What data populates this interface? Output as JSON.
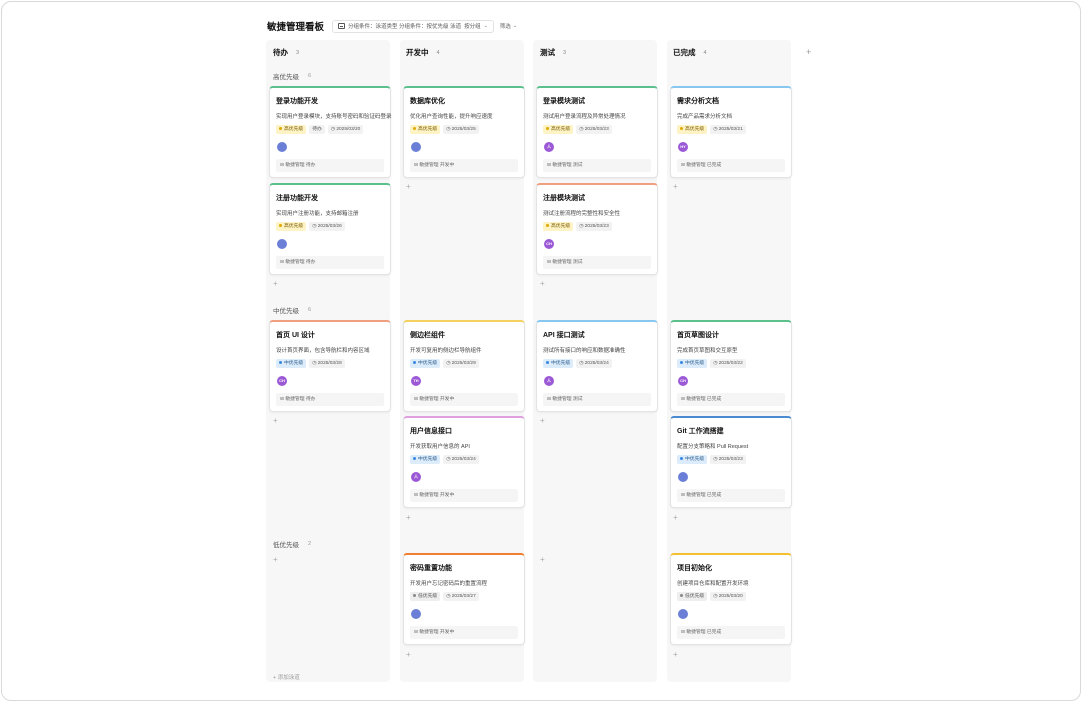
{
  "page": {
    "title": "敏捷管理看板",
    "group_by_label": "分组条件：泳道类型 分组条件：按优先级 泳道",
    "group_by_short": "按分组",
    "filter_label": "筛选"
  },
  "columns": [
    {
      "title": "待办",
      "count": "3"
    },
    {
      "title": "开发中",
      "count": "4"
    },
    {
      "title": "测试",
      "count": "3"
    },
    {
      "title": "已完成",
      "count": "4"
    }
  ],
  "swimlanes": [
    {
      "title": "高优先级",
      "count": "6"
    },
    {
      "title": "中优先级",
      "count": "6"
    },
    {
      "title": "低优先级",
      "count": "2"
    }
  ],
  "cards": [
    {
      "title": "登录功能开发",
      "desc": "实现用户登录模块，支持账号密码和验证码登录",
      "tag": "高优先级",
      "extra": "待办",
      "date": "2025/03/20",
      "avatar": "",
      "project": "敏捷管理 待办",
      "accent": "#5cc08c",
      "tagc": "y",
      "avc": "#6b7fd6"
    },
    {
      "title": "注册功能开发",
      "desc": "实现用户注册功能，支持邮箱注册",
      "tag": "高优先级",
      "extra": "",
      "date": "2025/03/26",
      "avatar": "",
      "project": "敏捷管理 待办",
      "accent": "#5cc08c",
      "tagc": "y",
      "avc": "#6b7fd6"
    },
    {
      "title": "数据库优化",
      "desc": "优化用户查询性能，提升响应速度",
      "tag": "高优先级",
      "extra": "",
      "date": "2025/03/25",
      "avatar": "",
      "project": "敏捷管理 开发中",
      "accent": "#5cc08c",
      "tagc": "y",
      "avc": "#6b7fd6"
    },
    {
      "title": "登录模块测试",
      "desc": "测试用户登录流程及异常处理情况",
      "tag": "高优先级",
      "extra": "",
      "date": "2025/03/23",
      "avatar": "人",
      "project": "敏捷管理 测试",
      "accent": "#5cc08c",
      "tagc": "y",
      "avc": "#9b59d6"
    },
    {
      "title": "注册模块测试",
      "desc": "测试注册流程的完整性和安全性",
      "tag": "高优先级",
      "extra": "",
      "date": "2025/03/23",
      "avatar": "CH",
      "project": "敏捷管理 测试",
      "accent": "#f0a080",
      "tagc": "y",
      "avc": "#9b59d6"
    },
    {
      "title": "需求分析文档",
      "desc": "完成产品需求分析文档",
      "tag": "高优先级",
      "extra": "",
      "date": "2025/03/21",
      "avatar": "HY",
      "project": "敏捷管理 已完成",
      "accent": "#88c8f0",
      "tagc": "y",
      "avc": "#9b59d6"
    },
    {
      "title": "首页 UI 设计",
      "desc": "设计首页界面，包含导航栏和内容区域",
      "tag": "中优先级",
      "extra": "",
      "date": "2025/03/28",
      "avatar": "CH",
      "project": "敏捷管理 待办",
      "accent": "#f0a080",
      "tagc": "b",
      "avc": "#9b59d6"
    },
    {
      "title": "侧边栏组件",
      "desc": "开发可复用的侧边栏导航组件",
      "tag": "中优先级",
      "extra": "",
      "date": "2025/03/29",
      "avatar": "TH",
      "project": "敏捷管理 开发中",
      "accent": "#f5d060",
      "tagc": "b",
      "avc": "#9b59d6"
    },
    {
      "title": "用户信息接口",
      "desc": "开发获取用户信息的 API",
      "tag": "中优先级",
      "extra": "",
      "date": "2025/03/24",
      "avatar": "人",
      "project": "敏捷管理 开发中",
      "accent": "#e0a0e0",
      "tagc": "b",
      "avc": "#9b59d6"
    },
    {
      "title": "API 接口测试",
      "desc": "测试所有接口的响应和数据准确性",
      "tag": "中优先级",
      "extra": "",
      "date": "2025/03/24",
      "avatar": "人",
      "project": "敏捷管理 测试",
      "accent": "#88c8f0",
      "tagc": "b",
      "avc": "#9b59d6"
    },
    {
      "title": "首页草图设计",
      "desc": "完成首页草图和交互原型",
      "tag": "中优先级",
      "extra": "",
      "date": "2025/03/22",
      "avatar": "CH",
      "project": "敏捷管理 已完成",
      "accent": "#5cc08c",
      "tagc": "b",
      "avc": "#9b59d6"
    },
    {
      "title": "Git 工作流搭建",
      "desc": "配置分支策略和 Pull Request",
      "tag": "中优先级",
      "extra": "",
      "date": "2025/03/23",
      "avatar": "",
      "project": "敏捷管理 已完成",
      "accent": "#4a8ad0",
      "tagc": "b",
      "avc": "#6b7fd6"
    },
    {
      "title": "密码重置功能",
      "desc": "开发用户忘记密码后的重置流程",
      "tag": "低优先级",
      "extra": "",
      "date": "2025/03/27",
      "avatar": "",
      "project": "敏捷管理 开发中",
      "accent": "#f08030",
      "tagc": "g",
      "avc": "#6b7fd6"
    },
    {
      "title": "项目初始化",
      "desc": "创建项目仓库和配置开发环境",
      "tag": "低优先级",
      "extra": "",
      "date": "2025/03/20",
      "avatar": "",
      "project": "敏捷管理 已完成",
      "accent": "#f5c030",
      "tagc": "g",
      "avc": "#6b7fd6"
    }
  ],
  "footer": {
    "add_lane": "+ 添加泳道"
  }
}
